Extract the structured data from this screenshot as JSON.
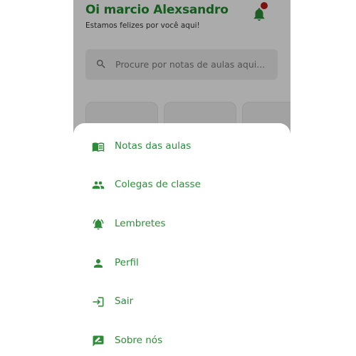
{
  "header": {
    "greeting": "Oi marcio Alexsandro",
    "subtitle": "Estamos felizes por você aqui!",
    "notification_icon": "bell-icon",
    "notification_badge_color": "#b71c1c"
  },
  "search": {
    "placeholder": "Procure por notas de aulas aqui...",
    "icon": "search-icon"
  },
  "colors": {
    "accent": "#2e8b3a",
    "title_green": "#1f8a2e"
  },
  "menu": {
    "items": [
      {
        "label": "Notas das aulas",
        "icon": "book-icon"
      },
      {
        "label": "Colegas de classe",
        "icon": "people-icon"
      },
      {
        "label": "Lembretes",
        "icon": "alarm-bell-icon"
      },
      {
        "label": "Perfil",
        "icon": "person-icon"
      },
      {
        "label": "Sair",
        "icon": "logout-icon"
      },
      {
        "label": "Sobre nós",
        "icon": "feedback-icon"
      }
    ]
  }
}
